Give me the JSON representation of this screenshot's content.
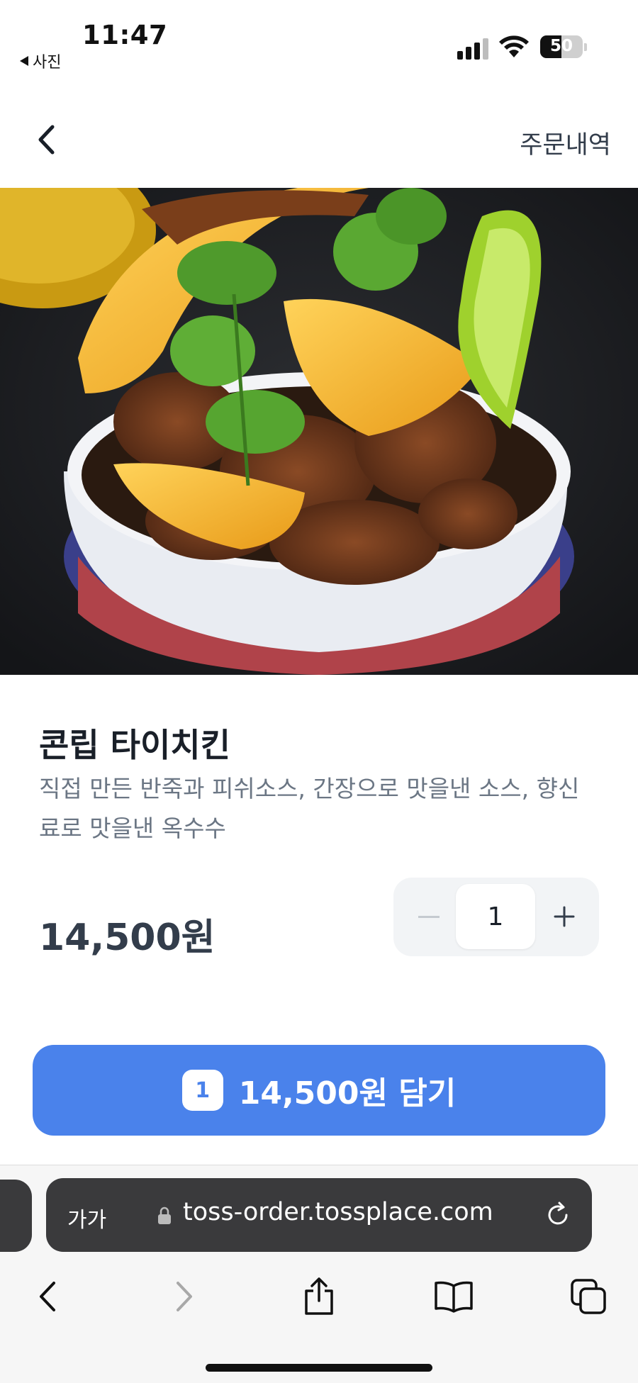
{
  "status_bar": {
    "time": "11:47",
    "back_app": "사진",
    "battery_level": "50",
    "signal_icon": "cellular-signal-icon",
    "wifi_icon": "wifi-icon"
  },
  "header": {
    "back_icon": "chevron-left-icon",
    "order_history": "주문내역"
  },
  "product": {
    "image_description": "food-photo",
    "name": "콘립 타이치킨",
    "description": "직접 만든 반죽과 피쉬소스, 간장으로 맛을낸 소스, 향신료로 맛을낸 옥수수",
    "price": "14,500원"
  },
  "quantity": {
    "value": "1",
    "minus_icon": "minus-icon",
    "plus_icon": "plus-icon"
  },
  "cart_button": {
    "count": "1",
    "label": "14,500원 담기",
    "color": "#4a82eb"
  },
  "browser": {
    "text_size": "가가",
    "url": "toss-order.tossplace.com",
    "lock_icon": "lock-icon",
    "reload_icon": "reload-icon",
    "nav_icons": [
      "back-arrow-icon",
      "forward-arrow-icon",
      "share-icon",
      "bookmarks-icon",
      "tabs-icon"
    ]
  }
}
